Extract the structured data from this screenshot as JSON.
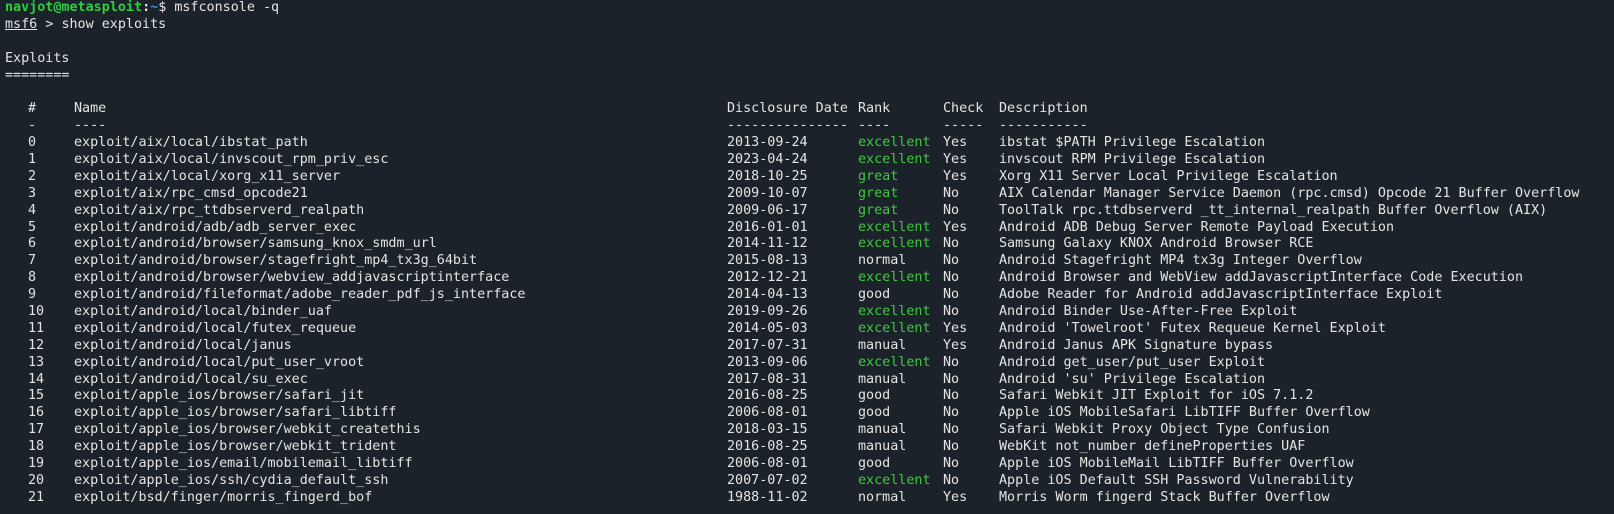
{
  "prompt": {
    "user": "navjot@metasploit",
    "sep": ":",
    "path": "~",
    "symbol": "$",
    "command": "msfconsole -q"
  },
  "msf_prompt": {
    "label": "msf6",
    "arrow": ">",
    "command": "show exploits"
  },
  "section": {
    "title": "Exploits",
    "underline": "========"
  },
  "table": {
    "headers": {
      "num": "#",
      "name": "Name",
      "date": "Disclosure Date",
      "rank": "Rank",
      "check": "Check",
      "desc": "Description"
    },
    "dividers": {
      "num": "-",
      "name": "----",
      "date": "---------------",
      "rank": "----",
      "check": "-----",
      "desc": "-----------"
    },
    "colors": {
      "green_rank": "#3ec93e"
    },
    "rows": [
      {
        "num": "0",
        "name": "exploit/aix/local/ibstat_path",
        "date": "2013-09-24",
        "rank": "excellent",
        "check": "Yes",
        "desc": "ibstat $PATH Privilege Escalation"
      },
      {
        "num": "1",
        "name": "exploit/aix/local/invscout_rpm_priv_esc",
        "date": "2023-04-24",
        "rank": "excellent",
        "check": "Yes",
        "desc": "invscout RPM Privilege Escalation"
      },
      {
        "num": "2",
        "name": "exploit/aix/local/xorg_x11_server",
        "date": "2018-10-25",
        "rank": "great",
        "check": "Yes",
        "desc": "Xorg X11 Server Local Privilege Escalation"
      },
      {
        "num": "3",
        "name": "exploit/aix/rpc_cmsd_opcode21",
        "date": "2009-10-07",
        "rank": "great",
        "check": "No",
        "desc": "AIX Calendar Manager Service Daemon (rpc.cmsd) Opcode 21 Buffer Overflow"
      },
      {
        "num": "4",
        "name": "exploit/aix/rpc_ttdbserverd_realpath",
        "date": "2009-06-17",
        "rank": "great",
        "check": "No",
        "desc": "ToolTalk rpc.ttdbserverd _tt_internal_realpath Buffer Overflow (AIX)"
      },
      {
        "num": "5",
        "name": "exploit/android/adb/adb_server_exec",
        "date": "2016-01-01",
        "rank": "excellent",
        "check": "Yes",
        "desc": "Android ADB Debug Server Remote Payload Execution"
      },
      {
        "num": "6",
        "name": "exploit/android/browser/samsung_knox_smdm_url",
        "date": "2014-11-12",
        "rank": "excellent",
        "check": "No",
        "desc": "Samsung Galaxy KNOX Android Browser RCE"
      },
      {
        "num": "7",
        "name": "exploit/android/browser/stagefright_mp4_tx3g_64bit",
        "date": "2015-08-13",
        "rank": "normal",
        "check": "No",
        "desc": "Android Stagefright MP4 tx3g Integer Overflow"
      },
      {
        "num": "8",
        "name": "exploit/android/browser/webview_addjavascriptinterface",
        "date": "2012-12-21",
        "rank": "excellent",
        "check": "No",
        "desc": "Android Browser and WebView addJavascriptInterface Code Execution"
      },
      {
        "num": "9",
        "name": "exploit/android/fileformat/adobe_reader_pdf_js_interface",
        "date": "2014-04-13",
        "rank": "good",
        "check": "No",
        "desc": "Adobe Reader for Android addJavascriptInterface Exploit"
      },
      {
        "num": "10",
        "name": "exploit/android/local/binder_uaf",
        "date": "2019-09-26",
        "rank": "excellent",
        "check": "No",
        "desc": "Android Binder Use-After-Free Exploit"
      },
      {
        "num": "11",
        "name": "exploit/android/local/futex_requeue",
        "date": "2014-05-03",
        "rank": "excellent",
        "check": "Yes",
        "desc": "Android 'Towelroot' Futex Requeue Kernel Exploit"
      },
      {
        "num": "12",
        "name": "exploit/android/local/janus",
        "date": "2017-07-31",
        "rank": "manual",
        "check": "Yes",
        "desc": "Android Janus APK Signature bypass"
      },
      {
        "num": "13",
        "name": "exploit/android/local/put_user_vroot",
        "date": "2013-09-06",
        "rank": "excellent",
        "check": "No",
        "desc": "Android get_user/put_user Exploit"
      },
      {
        "num": "14",
        "name": "exploit/android/local/su_exec",
        "date": "2017-08-31",
        "rank": "manual",
        "check": "No",
        "desc": "Android 'su' Privilege Escalation"
      },
      {
        "num": "15",
        "name": "exploit/apple_ios/browser/safari_jit",
        "date": "2016-08-25",
        "rank": "good",
        "check": "No",
        "desc": "Safari Webkit JIT Exploit for iOS 7.1.2"
      },
      {
        "num": "16",
        "name": "exploit/apple_ios/browser/safari_libtiff",
        "date": "2006-08-01",
        "rank": "good",
        "check": "No",
        "desc": "Apple iOS MobileSafari LibTIFF Buffer Overflow"
      },
      {
        "num": "17",
        "name": "exploit/apple_ios/browser/webkit_createthis",
        "date": "2018-03-15",
        "rank": "manual",
        "check": "No",
        "desc": "Safari Webkit Proxy Object Type Confusion"
      },
      {
        "num": "18",
        "name": "exploit/apple_ios/browser/webkit_trident",
        "date": "2016-08-25",
        "rank": "manual",
        "check": "No",
        "desc": "WebKit not_number defineProperties UAF"
      },
      {
        "num": "19",
        "name": "exploit/apple_ios/email/mobilemail_libtiff",
        "date": "2006-08-01",
        "rank": "good",
        "check": "No",
        "desc": "Apple iOS MobileMail LibTIFF Buffer Overflow"
      },
      {
        "num": "20",
        "name": "exploit/apple_ios/ssh/cydia_default_ssh",
        "date": "2007-07-02",
        "rank": "excellent",
        "check": "No",
        "desc": "Apple iOS Default SSH Password Vulnerability"
      },
      {
        "num": "21",
        "name": "exploit/bsd/finger/morris_fingerd_bof",
        "date": "1988-11-02",
        "rank": "normal",
        "check": "Yes",
        "desc": "Morris Worm fingerd Stack Buffer Overflow"
      }
    ]
  }
}
